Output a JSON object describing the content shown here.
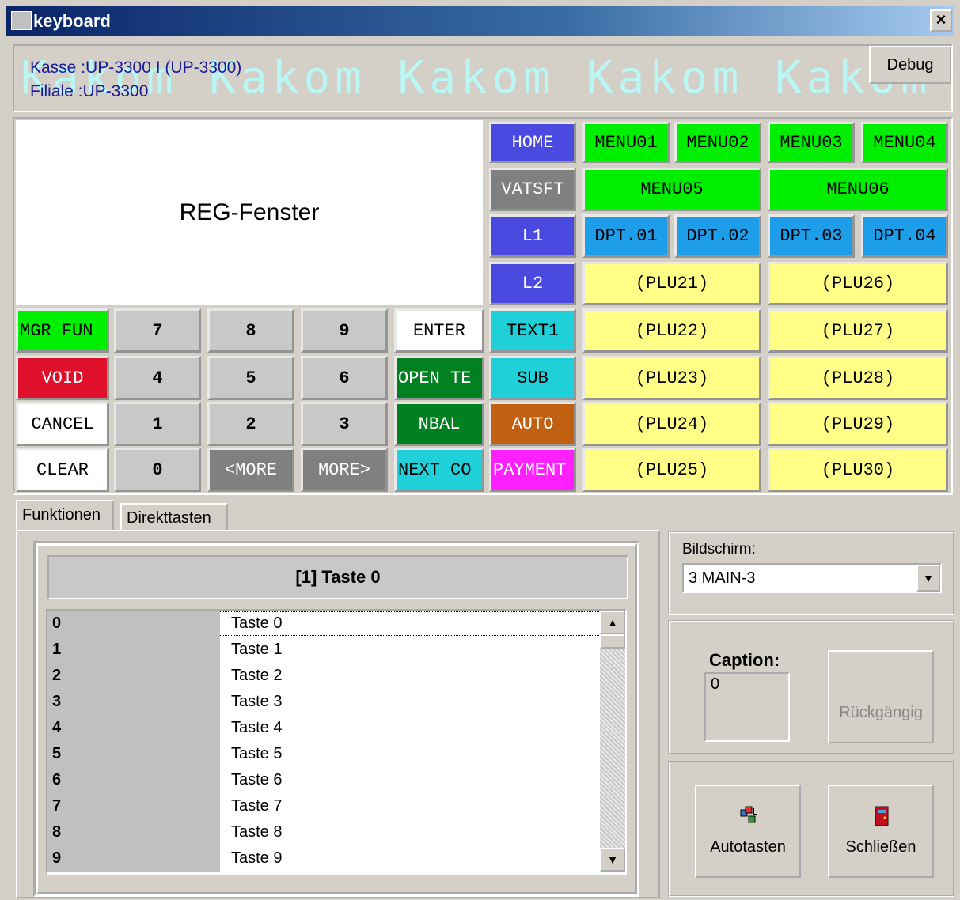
{
  "window": {
    "title": "keyboard",
    "close_glyph": "×"
  },
  "header": {
    "kasse": "Kasse :UP-3300 I (UP-3300)",
    "filiale": "Filiale :UP-3300",
    "watermark": "Kakom Kakom Kakom Kakom Kakom",
    "debug_label": "Debug"
  },
  "reg_window": {
    "label": "REG-Fenster"
  },
  "keys": [
    {
      "label": "HOME",
      "color": "#4a4ae0",
      "text_color": "#ffffff"
    },
    {
      "label": "MENU01",
      "color": "#00ee00",
      "text_color": "#000000"
    },
    {
      "label": "MENU02",
      "color": "#00ee00",
      "text_color": "#000000"
    },
    {
      "label": "MENU03",
      "color": "#00ee00",
      "text_color": "#000000"
    },
    {
      "label": "MENU04",
      "color": "#00ee00",
      "text_color": "#000000"
    },
    {
      "label": "VATSFT",
      "color": "#808080",
      "text_color": "#ffffff"
    },
    {
      "label": "MENU05",
      "color": "#00ee00",
      "text_color": "#000000"
    },
    {
      "label": "MENU06",
      "color": "#00ee00",
      "text_color": "#000000"
    },
    {
      "label": "L1",
      "color": "#4a4ae0",
      "text_color": "#ffffff"
    },
    {
      "label": "DPT.01",
      "color": "#1e9ee8",
      "text_color": "#000000"
    },
    {
      "label": "DPT.02",
      "color": "#1e9ee8",
      "text_color": "#000000"
    },
    {
      "label": "DPT.03",
      "color": "#1e9ee8",
      "text_color": "#000000"
    },
    {
      "label": "DPT.04",
      "color": "#1e9ee8",
      "text_color": "#000000"
    },
    {
      "label": "L2",
      "color": "#4a4ae0",
      "text_color": "#ffffff"
    },
    {
      "label": "(PLU21)",
      "color": "#ffff88",
      "text_color": "#000000"
    },
    {
      "label": "(PLU26)",
      "color": "#ffff88",
      "text_color": "#000000"
    },
    {
      "label": "MGR FUN",
      "color": "#00ee00",
      "text_color": "#000000"
    },
    {
      "label": "7",
      "color": "#c8c8c8",
      "text_color": "#000000"
    },
    {
      "label": "8",
      "color": "#c8c8c8",
      "text_color": "#000000"
    },
    {
      "label": "9",
      "color": "#c8c8c8",
      "text_color": "#000000"
    },
    {
      "label": "ENTER",
      "color": "#ffffff",
      "text_color": "#000000"
    },
    {
      "label": "TEXT1",
      "color": "#20d0d8",
      "text_color": "#000000"
    },
    {
      "label": "(PLU22)",
      "color": "#ffff88",
      "text_color": "#000000"
    },
    {
      "label": "(PLU27)",
      "color": "#ffff88",
      "text_color": "#000000"
    },
    {
      "label": "VOID",
      "color": "#e0102a",
      "text_color": "#ffffff"
    },
    {
      "label": "4",
      "color": "#c8c8c8",
      "text_color": "#000000"
    },
    {
      "label": "5",
      "color": "#c8c8c8",
      "text_color": "#000000"
    },
    {
      "label": "6",
      "color": "#c8c8c8",
      "text_color": "#000000"
    },
    {
      "label": "OPEN TE",
      "color": "#008020",
      "text_color": "#ffffff"
    },
    {
      "label": "SUB",
      "color": "#20d0d8",
      "text_color": "#000000"
    },
    {
      "label": "(PLU23)",
      "color": "#ffff88",
      "text_color": "#000000"
    },
    {
      "label": "(PLU28)",
      "color": "#ffff88",
      "text_color": "#000000"
    },
    {
      "label": "CANCEL",
      "color": "#ffffff",
      "text_color": "#000000"
    },
    {
      "label": "1",
      "color": "#c8c8c8",
      "text_color": "#000000"
    },
    {
      "label": "2",
      "color": "#c8c8c8",
      "text_color": "#000000"
    },
    {
      "label": "3",
      "color": "#c8c8c8",
      "text_color": "#000000"
    },
    {
      "label": "NBAL",
      "color": "#008020",
      "text_color": "#ffffff"
    },
    {
      "label": "AUTO",
      "color": "#c06010",
      "text_color": "#ffffff"
    },
    {
      "label": "(PLU24)",
      "color": "#ffff88",
      "text_color": "#000000"
    },
    {
      "label": "(PLU29)",
      "color": "#ffff88",
      "text_color": "#000000"
    },
    {
      "label": "CLEAR",
      "color": "#ffffff",
      "text_color": "#000000"
    },
    {
      "label": "0",
      "color": "#c8c8c8",
      "text_color": "#000000"
    },
    {
      "label": "<MORE",
      "color": "#808080",
      "text_color": "#ffffff"
    },
    {
      "label": "MORE>",
      "color": "#808080",
      "text_color": "#ffffff"
    },
    {
      "label": "NEXT CO",
      "color": "#20d0d8",
      "text_color": "#000000"
    },
    {
      "label": "PAYMENT",
      "color": "#ff20ff",
      "text_color": "#ffffff"
    },
    {
      "label": "(PLU25)",
      "color": "#ffff88",
      "text_color": "#000000"
    },
    {
      "label": "(PLU30)",
      "color": "#ffff88",
      "text_color": "#000000"
    }
  ],
  "tabs": [
    {
      "label": "Funktionen"
    },
    {
      "label": "Direkttasten"
    }
  ],
  "function_panel": {
    "heading": "[1] Taste 0",
    "list": [
      {
        "num": "0",
        "name": "Taste 0"
      },
      {
        "num": "1",
        "name": "Taste 1"
      },
      {
        "num": "2",
        "name": "Taste 2"
      },
      {
        "num": "3",
        "name": "Taste 3"
      },
      {
        "num": "4",
        "name": "Taste 4"
      },
      {
        "num": "5",
        "name": "Taste 5"
      },
      {
        "num": "6",
        "name": "Taste 6"
      },
      {
        "num": "7",
        "name": "Taste 7"
      },
      {
        "num": "8",
        "name": "Taste 8"
      },
      {
        "num": "9",
        "name": "Taste 9"
      }
    ]
  },
  "screen": {
    "label": "Bildschirm:",
    "value": "3 MAIN-3"
  },
  "caption": {
    "label": "Caption:",
    "value": "0",
    "undo_label": "Rückgängig"
  },
  "buttons": {
    "auto_label": "Autotasten",
    "close_label": "Schließen"
  }
}
